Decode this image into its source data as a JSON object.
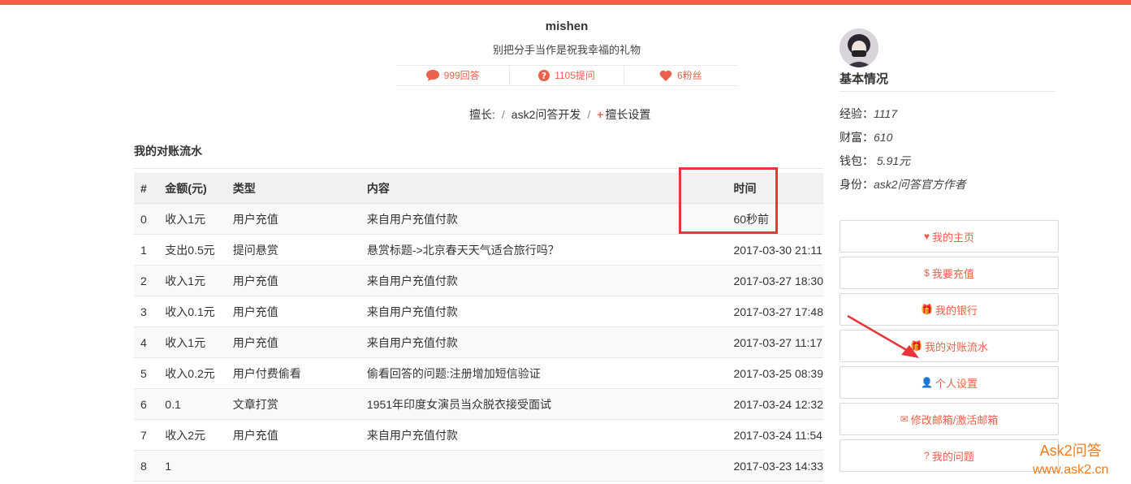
{
  "colors": {
    "accent": "#ec6149",
    "highlight_box": "#e8373a",
    "watermark": "#f07b1e"
  },
  "profile": {
    "username": "mishen",
    "signature": "别把分手当作是祝我幸福的礼物",
    "stats": [
      {
        "icon": "comment-icon",
        "label": "999回答"
      },
      {
        "icon": "question-icon",
        "label": "1105提问"
      },
      {
        "icon": "heart-icon",
        "label": "6粉丝"
      }
    ],
    "skills_label": "擅长:",
    "skills": [
      "ask2问答开发"
    ],
    "skills_setting": "擅长设置"
  },
  "section_title": "我的对账流水",
  "table": {
    "headers": [
      "#",
      "金额(元)",
      "类型",
      "内容",
      "时间"
    ],
    "rows": [
      [
        "0",
        "收入1元",
        "用户充值",
        "来自用户充值付款",
        "60秒前"
      ],
      [
        "1",
        "支出0.5元",
        "提问悬赏",
        "悬赏标题->北京春天天气适合旅行吗？",
        "2017-03-30 21:11"
      ],
      [
        "2",
        "收入1元",
        "用户充值",
        "来自用户充值付款",
        "2017-03-27 18:30"
      ],
      [
        "3",
        "收入0.1元",
        "用户充值",
        "来自用户充值付款",
        "2017-03-27 17:48"
      ],
      [
        "4",
        "收入1元",
        "用户充值",
        "来自用户充值付款",
        "2017-03-27 11:17"
      ],
      [
        "5",
        "收入0.2元",
        "用户付费偷看",
        "偷看回答的问题:注册增加短信验证",
        "2017-03-25 08:39"
      ],
      [
        "6",
        "0.1",
        "文章打赏",
        "1951年印度女演员当众脱衣接受面试",
        "2017-03-24 12:32"
      ],
      [
        "7",
        "收入2元",
        "用户充值",
        "来自用户充值付款",
        "2017-03-24 11:54"
      ],
      [
        "8",
        "1",
        "",
        "",
        "2017-03-23 14:33"
      ]
    ]
  },
  "sidebar": {
    "title": "基本情况",
    "info": [
      {
        "label": "经验：",
        "value": "1117"
      },
      {
        "label": "财富：",
        "value": "610"
      },
      {
        "label": "钱包：",
        "value": " 5.91元"
      },
      {
        "label": "身份：",
        "value": "ask2问答官方作者"
      }
    ],
    "menu": [
      {
        "icon": "♥",
        "label": "我的主页"
      },
      {
        "icon": "$",
        "label": " 我要充值"
      },
      {
        "icon": "🎁",
        "label": "我的银行"
      },
      {
        "icon": "🎁",
        "label": "我的对账流水"
      },
      {
        "icon": "👤",
        "label": "个人设置"
      },
      {
        "icon": "✉",
        "label": "修改邮箱/激活邮箱"
      },
      {
        "icon": "?",
        "label": "我的问题"
      }
    ]
  },
  "watermark": {
    "line1": "Ask2问答",
    "line2": "www.ask2.cn"
  }
}
